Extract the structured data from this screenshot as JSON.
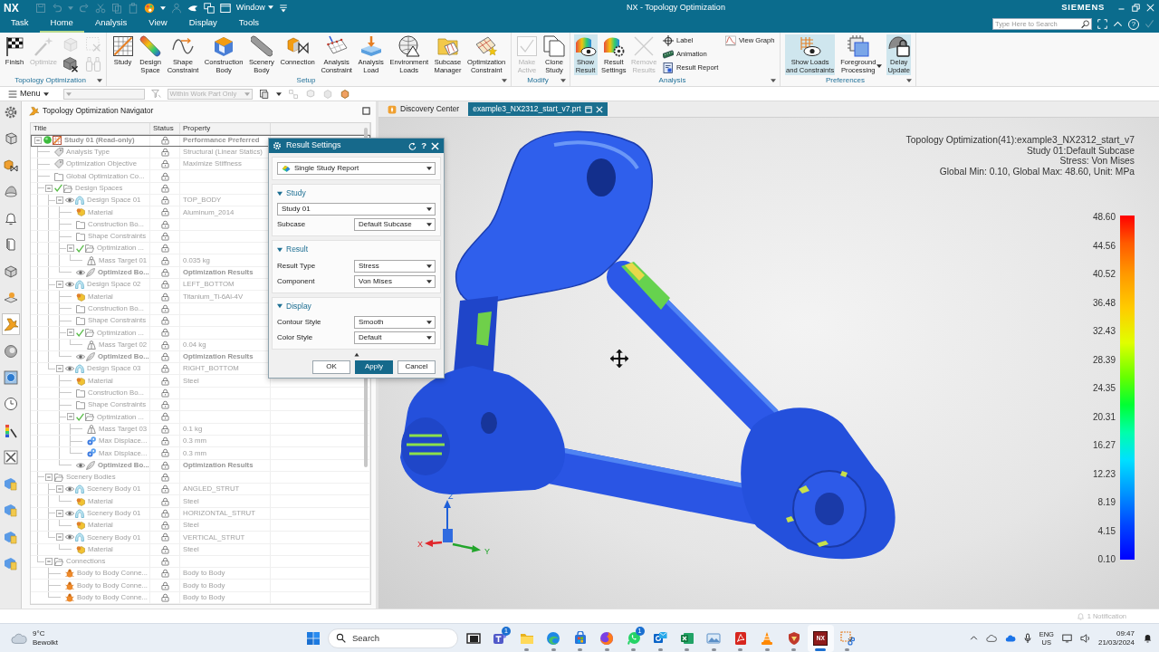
{
  "title_bar": {
    "logo": "NX",
    "window_menu": "Window",
    "title": "NX - Topology Optimization",
    "brand": "SIEMENS"
  },
  "ribbon_tabs": [
    {
      "label": "Task",
      "selected": false
    },
    {
      "label": "Home",
      "selected": true
    },
    {
      "label": "Analysis",
      "selected": false
    },
    {
      "label": "View",
      "selected": false
    },
    {
      "label": "Display",
      "selected": false
    },
    {
      "label": "Tools",
      "selected": false
    }
  ],
  "ribbon_right": {
    "placeholder": "Type Here to Search",
    "help": "?"
  },
  "ribbon_groups": [
    {
      "label": "Topology Optimization",
      "commands": [
        {
          "kind": "large",
          "label": "Finish",
          "disabled": false,
          "on": false
        },
        {
          "kind": "large",
          "label": "Optimize",
          "disabled": true,
          "on": false
        },
        {
          "kind": "icon",
          "disabled": true,
          "on": false
        },
        {
          "kind": "icon",
          "disabled": false,
          "on": false
        },
        {
          "kind": "icon",
          "disabled": true,
          "on": false
        },
        {
          "kind": "icon",
          "disabled": true,
          "on": false
        }
      ]
    },
    {
      "label": "Setup",
      "commands": [
        {
          "kind": "large",
          "label": "Study",
          "disabled": false,
          "on": false
        },
        {
          "kind": "large",
          "label": "Design\nSpace",
          "disabled": false,
          "on": false
        },
        {
          "kind": "large",
          "label": "Shape\nConstraint",
          "disabled": false,
          "on": false
        },
        {
          "kind": "large",
          "label": "Construction\nBody",
          "disabled": false,
          "on": false
        },
        {
          "kind": "large",
          "label": "Scenery\nBody",
          "disabled": false,
          "on": false
        },
        {
          "kind": "large",
          "label": "Connection",
          "disabled": false,
          "on": false
        },
        {
          "kind": "large",
          "label": "Analysis\nConstraint",
          "disabled": false,
          "on": false
        },
        {
          "kind": "large",
          "label": "Analysis\nLoad",
          "disabled": false,
          "on": false
        },
        {
          "kind": "large",
          "label": "Environment\nLoads",
          "disabled": false,
          "on": false
        },
        {
          "kind": "large",
          "label": "Subcase\nManager",
          "disabled": false,
          "on": false
        },
        {
          "kind": "large",
          "label": "Optimization\nConstraint",
          "disabled": false,
          "on": false
        }
      ]
    },
    {
      "label": "Modify",
      "commands": [
        {
          "kind": "large",
          "label": "Make\nActive",
          "disabled": true,
          "on": false
        },
        {
          "kind": "large",
          "label": "Clone\nStudy",
          "disabled": false,
          "on": false
        }
      ]
    },
    {
      "label": "Analysis",
      "commands": [
        {
          "kind": "large",
          "label": "Show\nResult",
          "disabled": false,
          "on": true
        },
        {
          "kind": "large",
          "label": "Result\nSettings",
          "disabled": false,
          "on": false
        },
        {
          "kind": "large",
          "label": "Remove\nResults",
          "disabled": true,
          "on": false
        },
        {
          "kind": "small",
          "label": "Label",
          "disabled": false,
          "on": false
        },
        {
          "kind": "small",
          "label": "Animation",
          "disabled": false,
          "on": false
        },
        {
          "kind": "small",
          "label": "Result Report",
          "disabled": false,
          "on": false
        },
        {
          "kind": "small",
          "label": "View Graph",
          "disabled": false,
          "on": false
        }
      ]
    },
    {
      "label": "Preferences",
      "commands": [
        {
          "kind": "large",
          "label": "Show Loads\nand Constraints",
          "disabled": false,
          "on": true
        },
        {
          "kind": "split",
          "label": "Foreground\nProcessing",
          "disabled": false,
          "on": false
        },
        {
          "kind": "large",
          "label": "Delay\nUpdate",
          "disabled": false,
          "on": true
        }
      ]
    }
  ],
  "command_bar": {
    "menu": "Menu",
    "scope": {
      "value": "Within Work Part Only",
      "disabled": true
    }
  },
  "resource_bar": [
    {
      "selected": false
    },
    {
      "selected": false
    },
    {
      "selected": false
    },
    {
      "selected": false
    },
    {
      "selected": false
    },
    {
      "selected": false
    },
    {
      "selected": false
    },
    {
      "selected": false
    },
    {
      "selected": true
    },
    {
      "selected": false
    },
    {
      "selected": false
    },
    {
      "selected": false
    },
    {
      "selected": false
    },
    {
      "selected": false
    },
    {
      "selected": false
    },
    {
      "selected": false
    },
    {
      "selected": false
    },
    {
      "selected": false
    }
  ],
  "navigator": {
    "title": "Topology Optimization Navigator",
    "columns": [
      "Title",
      "Status",
      "Property"
    ],
    "rows": [
      {
        "title": "Study 01 (Read-only)",
        "property": "Performance Preferred",
        "kind": "study",
        "selected": true,
        "checked": false,
        "expanded": true,
        "children": [
          {
            "title": "Analysis Type",
            "property": "Structural (Linear Statics)",
            "kind": "tag",
            "selected": false,
            "checked": false
          },
          {
            "title": "Optimization Objective",
            "property": "Maximize Stiffness",
            "kind": "tag",
            "selected": false,
            "checked": false
          },
          {
            "title": "Global Optimization Co...",
            "kind": "folder",
            "selected": false,
            "checked": false
          },
          {
            "title": "Design Spaces",
            "kind": "folder",
            "selected": false,
            "checked": true,
            "expanded": true,
            "children": [
              {
                "title": "Design Space 01",
                "property": "TOP_BODY",
                "kind": "body",
                "selected": false,
                "checked": false,
                "expanded": true,
                "children": [
                  {
                    "title": "Material",
                    "property": "Aluminum_2014",
                    "kind": "material",
                    "selected": false,
                    "checked": false
                  },
                  {
                    "title": "Construction Bo...",
                    "kind": "folder",
                    "selected": false,
                    "checked": false
                  },
                  {
                    "title": "Shape Constraints",
                    "kind": "folder",
                    "selected": false,
                    "checked": false
                  },
                  {
                    "title": "Optimization ...",
                    "kind": "folder",
                    "selected": false,
                    "checked": true,
                    "expanded": true,
                    "children": [
                      {
                        "title": "Mass Target 01",
                        "property": "0.035 kg",
                        "kind": "mass",
                        "selected": false,
                        "checked": false
                      }
                    ]
                  },
                  {
                    "title": "Optimized Bo...",
                    "property": "Optimization Results",
                    "kind": "result",
                    "selected": false,
                    "checked": false
                  }
                ]
              },
              {
                "title": "Design Space 02",
                "property": "LEFT_BOTTOM",
                "kind": "body",
                "selected": false,
                "checked": false,
                "expanded": true,
                "children": [
                  {
                    "title": "Material",
                    "property": "Titanium_Ti-6Al-4V",
                    "kind": "material",
                    "selected": false,
                    "checked": false
                  },
                  {
                    "title": "Construction Bo...",
                    "kind": "folder",
                    "selected": false,
                    "checked": false
                  },
                  {
                    "title": "Shape Constraints",
                    "kind": "folder",
                    "selected": false,
                    "checked": false
                  },
                  {
                    "title": "Optimization ...",
                    "kind": "folder",
                    "selected": false,
                    "checked": true,
                    "expanded": true,
                    "children": [
                      {
                        "title": "Mass Target 02",
                        "property": "0.04 kg",
                        "kind": "mass",
                        "selected": false,
                        "checked": false
                      }
                    ]
                  },
                  {
                    "title": "Optimized Bo...",
                    "property": "Optimization Results",
                    "kind": "result",
                    "selected": false,
                    "checked": false
                  }
                ]
              },
              {
                "title": "Design Space 03",
                "property": "RIGHT_BOTTOM",
                "kind": "body",
                "selected": false,
                "checked": false,
                "expanded": true,
                "children": [
                  {
                    "title": "Material",
                    "property": "Steel",
                    "kind": "material",
                    "selected": false,
                    "checked": false
                  },
                  {
                    "title": "Construction Bo...",
                    "kind": "folder",
                    "selected": false,
                    "checked": false
                  },
                  {
                    "title": "Shape Constraints",
                    "kind": "folder",
                    "selected": false,
                    "checked": false
                  },
                  {
                    "title": "Optimization ...",
                    "kind": "folder",
                    "selected": false,
                    "checked": true,
                    "expanded": true,
                    "children": [
                      {
                        "title": "Mass Target 03",
                        "property": "0.1 kg",
                        "kind": "mass",
                        "selected": false,
                        "checked": false
                      },
                      {
                        "title": "Max Displace...",
                        "property": "0.3 mm",
                        "kind": "displacement",
                        "selected": false,
                        "checked": false
                      },
                      {
                        "title": "Max Displace...",
                        "property": "0.3 mm",
                        "kind": "displacement",
                        "selected": false,
                        "checked": false
                      }
                    ]
                  },
                  {
                    "title": "Optimized Bo...",
                    "property": "Optimization Results",
                    "kind": "result",
                    "selected": false,
                    "checked": false
                  }
                ]
              }
            ]
          },
          {
            "title": "Scenery Bodies",
            "kind": "folder",
            "selected": false,
            "checked": false,
            "expanded": true,
            "children": [
              {
                "title": "Scenery Body 01",
                "property": "ANGLED_STRUT",
                "kind": "body",
                "selected": false,
                "checked": false,
                "expanded": true,
                "children": [
                  {
                    "title": "Material",
                    "property": "Steel",
                    "kind": "material",
                    "selected": false,
                    "checked": false
                  }
                ]
              },
              {
                "title": "Scenery Body 01",
                "property": "HORIZONTAL_STRUT",
                "kind": "body",
                "selected": false,
                "checked": false,
                "expanded": true,
                "children": [
                  {
                    "title": "Material",
                    "property": "Steel",
                    "kind": "material",
                    "selected": false,
                    "checked": false
                  }
                ]
              },
              {
                "title": "Scenery Body 01",
                "property": "VERTICAL_STRUT",
                "kind": "body",
                "selected": false,
                "checked": false,
                "expanded": true,
                "children": [
                  {
                    "title": "Material",
                    "property": "Steel",
                    "kind": "material",
                    "selected": false,
                    "checked": false
                  }
                ]
              }
            ]
          },
          {
            "title": "Connections",
            "kind": "folder",
            "selected": false,
            "checked": false,
            "expanded": true,
            "children": [
              {
                "title": "Body to Body Conne...",
                "property": "Body to Body",
                "kind": "connection",
                "selected": false,
                "checked": false
              },
              {
                "title": "Body to Body Conne...",
                "property": "Body to Body",
                "kind": "connection",
                "selected": false,
                "checked": false
              },
              {
                "title": "Body to Body Conne...",
                "property": "Body to Body",
                "kind": "connection",
                "selected": false,
                "checked": false
              }
            ]
          }
        ]
      }
    ]
  },
  "graphics_tabs": [
    {
      "label": "Discovery Center",
      "selected": false
    },
    {
      "label": "example3_NX2312_start_v7.prt",
      "selected": true
    }
  ],
  "viewport": {
    "info": [
      "Topology Optimization(41):example3_NX2312_start_v7",
      "Study 01:Default Subcase",
      "Stress: Von Mises",
      "Global Min: 0.10, Global Max: 48.60, Unit: MPa"
    ],
    "legend": [
      "48.60",
      "44.56",
      "40.52",
      "36.48",
      "32.43",
      "28.39",
      "24.35",
      "20.31",
      "16.27",
      "12.23",
      "8.19",
      "4.15",
      "0.10"
    ],
    "triad": [
      "Z",
      "X",
      "Y"
    ]
  },
  "dialog": {
    "title": "Result Settings",
    "help": "?",
    "report": "Single Study Report",
    "sections": [
      {
        "label": "Study",
        "expanded": true,
        "fields": [
          {
            "value": "Study 01"
          },
          {
            "label": "Subcase",
            "value": "Default Subcase"
          }
        ]
      },
      {
        "label": "Result",
        "expanded": true,
        "fields": [
          {
            "label": "Result Type",
            "value": "Stress"
          },
          {
            "label": "Component",
            "value": "Von Mises"
          }
        ]
      },
      {
        "label": "Display",
        "expanded": true,
        "fields": [
          {
            "label": "Contour Style",
            "value": "Smooth"
          },
          {
            "label": "Color Style",
            "value": "Default"
          }
        ]
      }
    ],
    "buttons": [
      {
        "label": "OK",
        "primary": false
      },
      {
        "label": "Apply",
        "primary": true
      },
      {
        "label": "Cancel",
        "primary": false
      }
    ]
  },
  "status_bar": {
    "notification": "1 Notification"
  },
  "taskbar": {
    "weather": {
      "temperature": "9°C",
      "condition": "Bewolkt"
    },
    "search": {
      "placeholder": "Search"
    },
    "apps": [
      {
        "running": false,
        "selected": false
      },
      {
        "badge": "1",
        "running": false,
        "selected": false
      },
      {
        "running": true,
        "selected": false
      },
      {
        "running": true,
        "selected": false
      },
      {
        "running": true,
        "selected": false
      },
      {
        "running": true,
        "selected": false
      },
      {
        "badge": "1",
        "running": true,
        "selected": false
      },
      {
        "running": true,
        "selected": false
      },
      {
        "running": true,
        "selected": false
      },
      {
        "running": true,
        "selected": false
      },
      {
        "running": true,
        "selected": false
      },
      {
        "running": true,
        "selected": false
      },
      {
        "running": true,
        "selected": false
      },
      {
        "label": "NX",
        "running": true,
        "selected": true
      },
      {
        "running": true,
        "selected": false
      }
    ],
    "language": "ENG",
    "region": "US",
    "time": "09:47",
    "date": "21/03/2024"
  }
}
